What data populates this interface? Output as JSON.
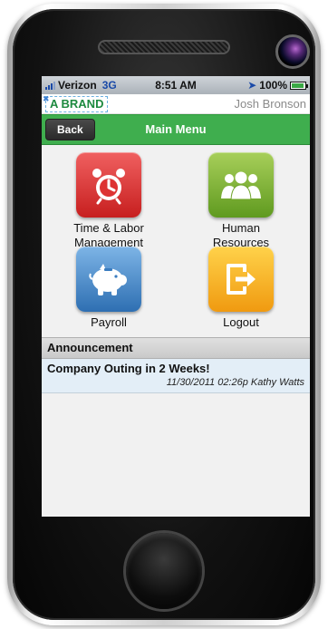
{
  "status_bar": {
    "carrier": "Verizon",
    "network": "3G",
    "time": "8:51 AM",
    "battery": "100%"
  },
  "brand_bar": {
    "logo": "A BRAND",
    "user_name": "Josh Bronson"
  },
  "nav_bar": {
    "back_label": "Back",
    "title": "Main Menu"
  },
  "menu": {
    "items": [
      {
        "line1": "Time & Labor",
        "line2": "Management",
        "icon": "alarm-clock-icon",
        "color": "#d83030"
      },
      {
        "line1": "Human",
        "line2": "Resources",
        "icon": "people-icon",
        "color": "#7db53a"
      },
      {
        "line1": "Payroll",
        "line2": "",
        "icon": "piggy-bank-icon",
        "color": "#4a8fd0"
      },
      {
        "line1": "Logout",
        "line2": "",
        "icon": "logout-icon",
        "color": "#f5b21f"
      }
    ]
  },
  "announcement": {
    "header": "Announcement",
    "title": "Company Outing in 2 Weeks!",
    "meta": "11/30/2011 02:26p Kathy Watts"
  },
  "colors": {
    "nav_green": "#3fae4e",
    "brand_green": "#1d8a3f"
  }
}
